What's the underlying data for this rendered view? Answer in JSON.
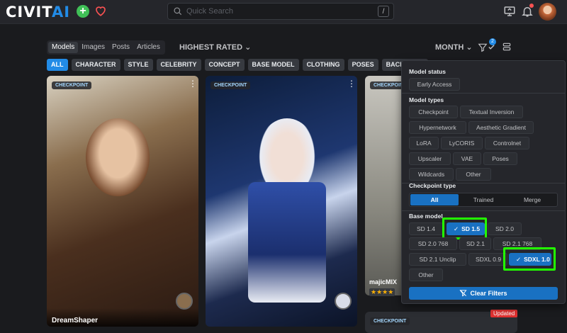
{
  "header": {
    "logo_left": "CIVIT",
    "logo_right": "AI",
    "search_placeholder": "Quick Search",
    "search_shortcut": "/",
    "icons": [
      "plus-icon",
      "heart-icon",
      "search-icon",
      "upload-icon",
      "bell-icon",
      "avatar"
    ]
  },
  "subnav": {
    "tabs": [
      "Models",
      "Images",
      "Posts",
      "Articles"
    ],
    "active": "Models"
  },
  "sort": {
    "label": "HIGHEST RATED"
  },
  "period": {
    "label": "MONTH"
  },
  "filter": {
    "badge_count": "2"
  },
  "chips": [
    "ALL",
    "CHARACTER",
    "STYLE",
    "CELEBRITY",
    "CONCEPT",
    "BASE MODEL",
    "CLOTHING",
    "POSES",
    "BACKGROU"
  ],
  "cards": [
    {
      "badge": "CHECKPOINT",
      "name": "DreamShaper"
    },
    {
      "badge": "CHECKPOINT",
      "name": ""
    },
    {
      "badge": "CHECKPOINT",
      "name": "majicMIX"
    },
    {
      "badge": "CHECKPOINT",
      "name": "",
      "tag": "Updated"
    }
  ],
  "rating_stars": "★★★★",
  "panel": {
    "model_status": {
      "title": "Model status",
      "options": [
        "Early Access"
      ]
    },
    "model_types": {
      "title": "Model types",
      "options": [
        "Checkpoint",
        "Textual Inversion",
        "Hypernetwork",
        "Aesthetic Gradient",
        "LoRA",
        "LyCORIS",
        "Controlnet",
        "Upscaler",
        "VAE",
        "Poses",
        "Wildcards",
        "Other"
      ]
    },
    "checkpoint_type": {
      "title": "Checkpoint type",
      "options": [
        "All",
        "Trained",
        "Merge"
      ],
      "selected": "All"
    },
    "base_model": {
      "title": "Base model",
      "options": [
        "SD 1.4",
        "SD 1.5",
        "SD 2.0",
        "SD 2.0 768",
        "SD 2.1",
        "SD 2.1 768",
        "SD 2.1 Unclip",
        "SDXL 0.9",
        "SDXL 1.0",
        "Other"
      ],
      "selected": [
        "SD 1.5",
        "SDXL 1.0"
      ]
    },
    "clear_label": "Clear Filters"
  },
  "colors": {
    "accent": "#1971c2",
    "highlight": "#22ff00",
    "bg": "#1a1b1e",
    "panel": "#25262b"
  }
}
